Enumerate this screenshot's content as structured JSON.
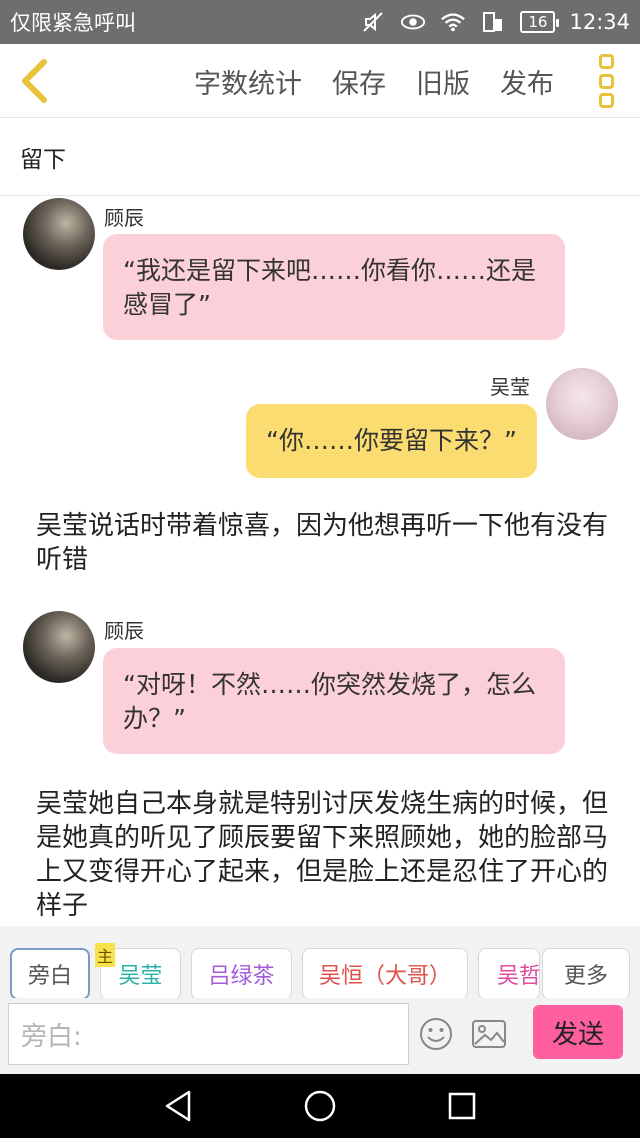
{
  "status_bar": {
    "left_text": "仅限紧急呼叫",
    "battery": "16",
    "time": "12:34",
    "icons": [
      "mute-icon",
      "eye-icon",
      "wifi-icon",
      "sim-icon",
      "battery-icon"
    ]
  },
  "toolbar": {
    "back_icon": "chevron-left-icon",
    "actions": [
      "字数统计",
      "保存",
      "旧版",
      "发布"
    ],
    "more_icon": "more-vertical-icon",
    "accent": "#e8c23a"
  },
  "chapter_title": "留下",
  "messages": [
    {
      "type": "left",
      "name": "顾辰",
      "text": "“我还是留下来吧……你看你……还是感冒了”"
    },
    {
      "type": "right",
      "name": "吴莹",
      "text": "“你……你要留下来？”"
    },
    {
      "type": "narration",
      "text": "吴莹说话时带着惊喜，因为他想再听一下他有没有听错"
    },
    {
      "type": "left",
      "name": "顾辰",
      "text": "“对呀！不然……你突然发烧了，怎么办？”"
    },
    {
      "type": "narration",
      "text": "吴莹她自己本身就是特别讨厌发烧生病的时候，但是她真的听见了顾辰要留下来照顾她，她的脸部马上又变得开心了起来，但是脸上还是忍住了开心的样子"
    }
  ],
  "roles": [
    {
      "label": "旁白",
      "color": "#555555"
    },
    {
      "label": "吴莹",
      "color": "#2bb3a6",
      "tag": "主"
    },
    {
      "label": "吕绿茶",
      "color": "#a35bd8"
    },
    {
      "label": "吴恒（大哥）",
      "color": "#e0504a"
    },
    {
      "label": "吴哲",
      "color": "#e04aa0"
    }
  ],
  "roles_more": "更多",
  "input": {
    "placeholder": "旁白:"
  },
  "send_label": "发送",
  "colors": {
    "pink_bubble": "#fcd0d9",
    "yellow_bubble": "#fbdc71",
    "send": "#ff5f9e"
  }
}
